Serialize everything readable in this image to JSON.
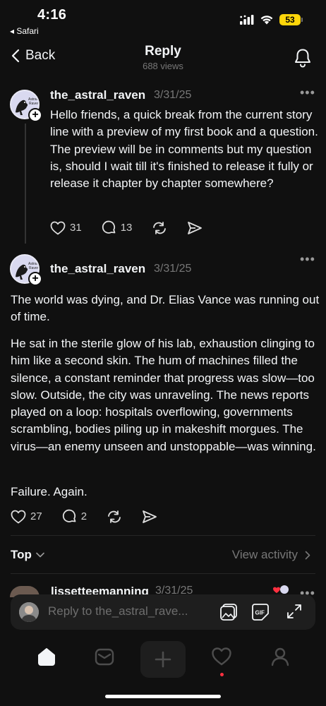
{
  "status": {
    "time": "4:16",
    "back_app": "◂ Safari",
    "battery": "53"
  },
  "nav": {
    "back_label": "Back",
    "title": "Reply",
    "views": "688 views"
  },
  "post1": {
    "username": "the_astral_raven",
    "date": "3/31/25",
    "text": "Hello friends, a quick break from the current story line with a preview of my first book and a question. The preview will be in comments but my question is, should I wait till it's finished to release it fully or release it chapter by chapter somewhere?",
    "likes": "31",
    "comments": "13"
  },
  "post2": {
    "username": "the_astral_raven",
    "date": "3/31/25",
    "paragraphs": [
      "The world was dying, and Dr. Elias Vance was running out of time.",
      "He sat in the sterile glow of his lab, exhaustion clinging to him like a second skin. The hum of machines filled the silence, a constant reminder that progress was slow—too slow. Outside, the city was unraveling. The news reports played on a loop: hospitals overflowing, governments scrambling, bodies piling up in makeshift morgues. The virus—an enemy unseen and unstoppable—was winning.",
      "Failure. Again."
    ],
    "likes": "27",
    "comments": "2"
  },
  "sort": {
    "label": "Top",
    "view_activity": "View activity"
  },
  "peek": {
    "username": "lissetteemanning",
    "date": "3/31/25"
  },
  "reply": {
    "placeholder": "Reply to the_astral_rave..."
  },
  "avatar_text": "Astral Raven",
  "colors": {
    "background": "#101010",
    "accent_dot": "#ff3040",
    "battery": "#ffd60a"
  }
}
